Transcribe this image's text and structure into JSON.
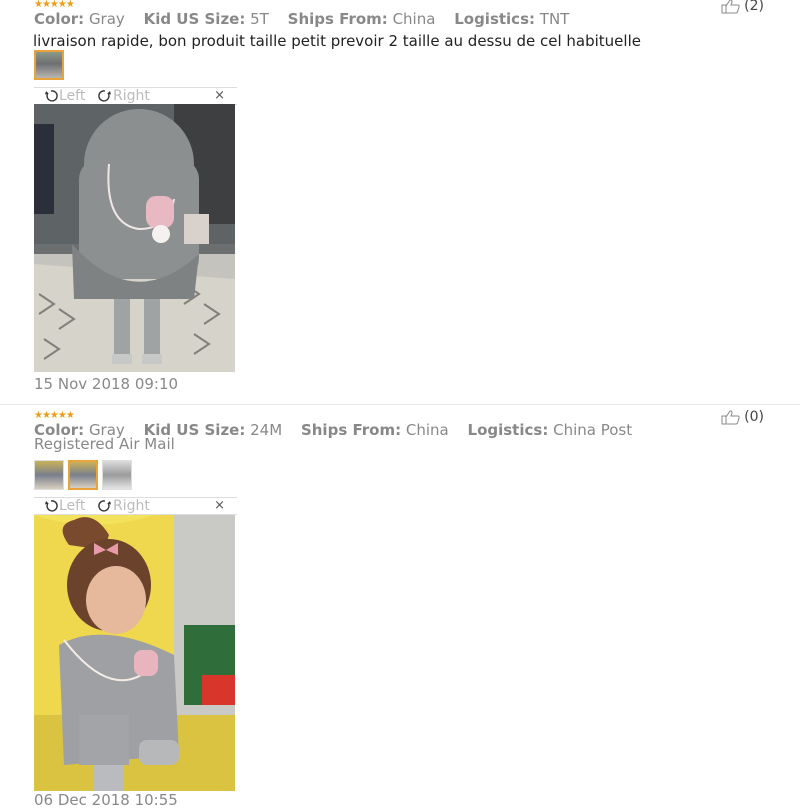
{
  "reviews": [
    {
      "stars": "★★★★★",
      "helpful_count": "(2)",
      "attributes": {
        "color_label": "Color:",
        "color_value": "Gray",
        "size_label": "Kid US Size:",
        "size_value": "5T",
        "ships_label": "Ships From:",
        "ships_value": "China",
        "logistics_label": "Logistics:",
        "logistics_value": "TNT"
      },
      "feedback": "livraison rapide, bon produit taille petit prevoir 2 taille au dessu de cel habituelle",
      "viewer": {
        "left_label": "Left",
        "right_label": "Right",
        "close": "×"
      },
      "date": "15 Nov 2018 09:10"
    },
    {
      "stars": "★★★★★",
      "helpful_count": "(0)",
      "attributes": {
        "color_label": "Color:",
        "color_value": "Gray",
        "size_label": "Kid US Size:",
        "size_value": "24M",
        "ships_label": "Ships From:",
        "ships_value": "China",
        "logistics_label": "Logistics:",
        "logistics_value": "China Post Registered Air Mail"
      },
      "viewer": {
        "left_label": "Left",
        "right_label": "Right",
        "close": "×"
      },
      "date": "06 Dec 2018 10:55"
    }
  ],
  "colors": {
    "star": "#f39c12",
    "active_thumb_border": "#e8a33d",
    "muted_text": "#888888"
  },
  "icons": [
    "thumbs-up-icon",
    "rotate-left-icon",
    "rotate-right-icon",
    "close-icon",
    "star-icon"
  ]
}
